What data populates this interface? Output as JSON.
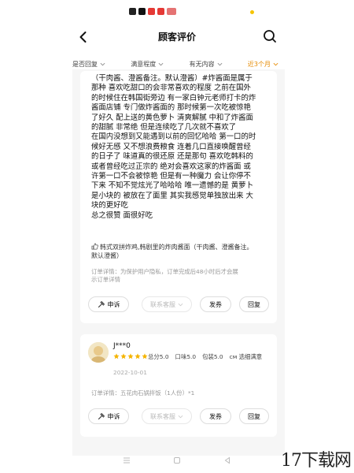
{
  "statusbar": {
    "icons": [
      "app-icon-1",
      "app-icon-2",
      "app-icon-3",
      "app-icon-4",
      "app-icon-5"
    ],
    "icon_colors": [
      "#222222",
      "#111111",
      "#e53935",
      "#e53935",
      "#e57373"
    ],
    "dot_color": "#f5c400"
  },
  "header": {
    "title": "顾客评价"
  },
  "filters": [
    {
      "label": "是否回复",
      "active": false
    },
    {
      "label": "满意程度",
      "active": false
    },
    {
      "label": "有无内容",
      "active": false
    },
    {
      "label": "近3个月",
      "active": true
    }
  ],
  "colors": {
    "accent": "#e68a00",
    "star": "#f5b400"
  },
  "review1": {
    "text_lines": [
      "（干肉酱、澄酱备注。默认澄酱）#炸酱面是属于",
      "那种 喜欢吃甜口的会非常喜欢的程度 之前在国外",
      "的时候住在韩国街旁边 有一家白钟元老师打卡的炸",
      "酱面店铺 专门做炸酱面的 那时候第一次吃被惊艳",
      "了好久 配上送的黄色萝卜 清爽解腻 中和了炸酱面",
      "的甜腻 非常绝 但是连续吃了几次就不喜欢了",
      "在国内没想到又能遇到以前的回忆哈哈 第一口的时",
      "候好无感 又不想浪费粮食 连着几口直接唤醒曾经",
      "的日子了 味道真的很还原 还是那句 喜欢吃韩料的",
      "或者曾经吃过正宗的 绝对会喜欢这家的炸酱面 或",
      "许第一口不会被惊艳 但是有一种魔力 会让你停不",
      "下来 不知不觉炫光了哈哈哈 唯一遗憾的是 黄萝卜",
      "是小块的 被放在了面里 其实我感觉单独放出来 大",
      "块的更好吃",
      "总之很赞 面很好吃"
    ],
    "dish_line_1": "韩式双拼炸鸡,韩剧里的炸肉酱面（干肉酱、澄酱备注。",
    "dish_line_2": "默认澄酱）",
    "detail_line_1": "订单详情：为保护用户隐私，订单完成后48小时后才会展",
    "detail_line_2": "示订单详情",
    "buttons": {
      "complain": "申诉",
      "contact": "联系客服",
      "coupon": "发券",
      "reply": "回复"
    }
  },
  "review2": {
    "username": "J***0",
    "stars": 5,
    "total_score": "总分5.0",
    "taste_score": "口味5.0",
    "package_score": "包装5.0",
    "more": "см 选细满意",
    "date": "2022-10-01",
    "order_detail": "订单详情：五花肉石锅拌饭（1人份）*1",
    "buttons": {
      "complain": "申诉",
      "contact": "联系客服",
      "coupon": "发券",
      "reply": "回复"
    }
  },
  "watermark": "17下载网"
}
